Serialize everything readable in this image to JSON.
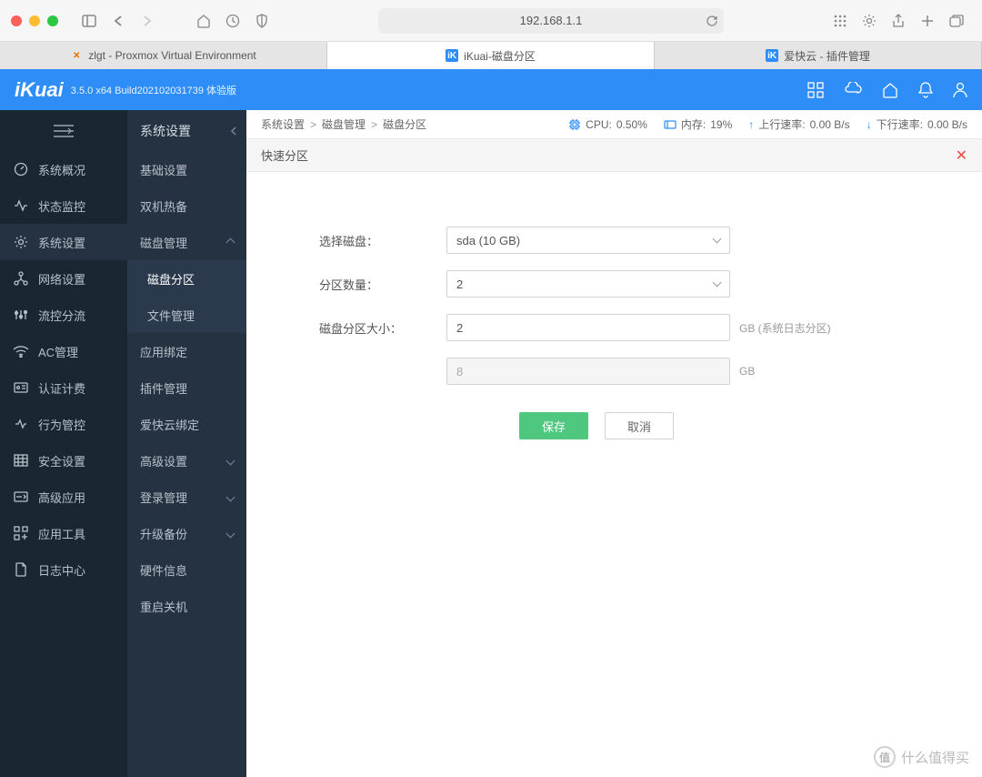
{
  "browser": {
    "url": "192.168.1.1",
    "tabs": [
      {
        "label": "zlgt - Proxmox Virtual Environment",
        "icon": "px"
      },
      {
        "label": "iKuai-磁盘分区",
        "icon": "ik",
        "active": true
      },
      {
        "label": "爱快云 - 插件管理",
        "icon": "ik"
      }
    ]
  },
  "app": {
    "logo": "iKuai",
    "version": "3.5.0 x64 Build202102031739 体验版"
  },
  "sidebar1": [
    {
      "label": "系统概况",
      "icon": "dashboard"
    },
    {
      "label": "状态监控",
      "icon": "monitor"
    },
    {
      "label": "系统设置",
      "icon": "gear",
      "active": true
    },
    {
      "label": "网络设置",
      "icon": "network"
    },
    {
      "label": "流控分流",
      "icon": "flow"
    },
    {
      "label": "AC管理",
      "icon": "wifi"
    },
    {
      "label": "认证计费",
      "icon": "auth"
    },
    {
      "label": "行为管控",
      "icon": "behavior"
    },
    {
      "label": "安全设置",
      "icon": "security"
    },
    {
      "label": "高级应用",
      "icon": "advanced"
    },
    {
      "label": "应用工具",
      "icon": "tools"
    },
    {
      "label": "日志中心",
      "icon": "log"
    }
  ],
  "sidebar2": {
    "title": "系统设置",
    "items": [
      {
        "label": "基础设置"
      },
      {
        "label": "双机热备"
      },
      {
        "label": "磁盘管理",
        "expandable": true,
        "expanded": true
      },
      {
        "label": "磁盘分区",
        "highlighted": true,
        "sub": true
      },
      {
        "label": "文件管理",
        "sub": true
      },
      {
        "label": "应用绑定"
      },
      {
        "label": "插件管理"
      },
      {
        "label": "爱快云绑定"
      },
      {
        "label": "高级设置",
        "expandable": true
      },
      {
        "label": "登录管理",
        "expandable": true
      },
      {
        "label": "升级备份",
        "expandable": true
      },
      {
        "label": "硬件信息"
      },
      {
        "label": "重启关机"
      }
    ]
  },
  "breadcrumb": [
    "系统设置",
    "磁盘管理",
    "磁盘分区"
  ],
  "stats": {
    "cpu_label": "CPU:",
    "cpu_value": "0.50%",
    "mem_label": "内存:",
    "mem_value": "19%",
    "up_label": "上行速率:",
    "up_value": "0.00 B/s",
    "down_label": "下行速率:",
    "down_value": "0.00 B/s"
  },
  "panel": {
    "title": "快速分区",
    "form": {
      "select_disk_label": "选择磁盘：",
      "select_disk_value": "sda (10 GB)",
      "partition_count_label": "分区数量：",
      "partition_count_value": "2",
      "partition_size_label": "磁盘分区大小：",
      "partition_size_1_value": "2",
      "partition_size_1_suffix": "GB (系统日志分区)",
      "partition_size_2_value": "8",
      "partition_size_2_suffix": "GB",
      "save_label": "保存",
      "cancel_label": "取消"
    }
  },
  "watermark": "什么值得买"
}
